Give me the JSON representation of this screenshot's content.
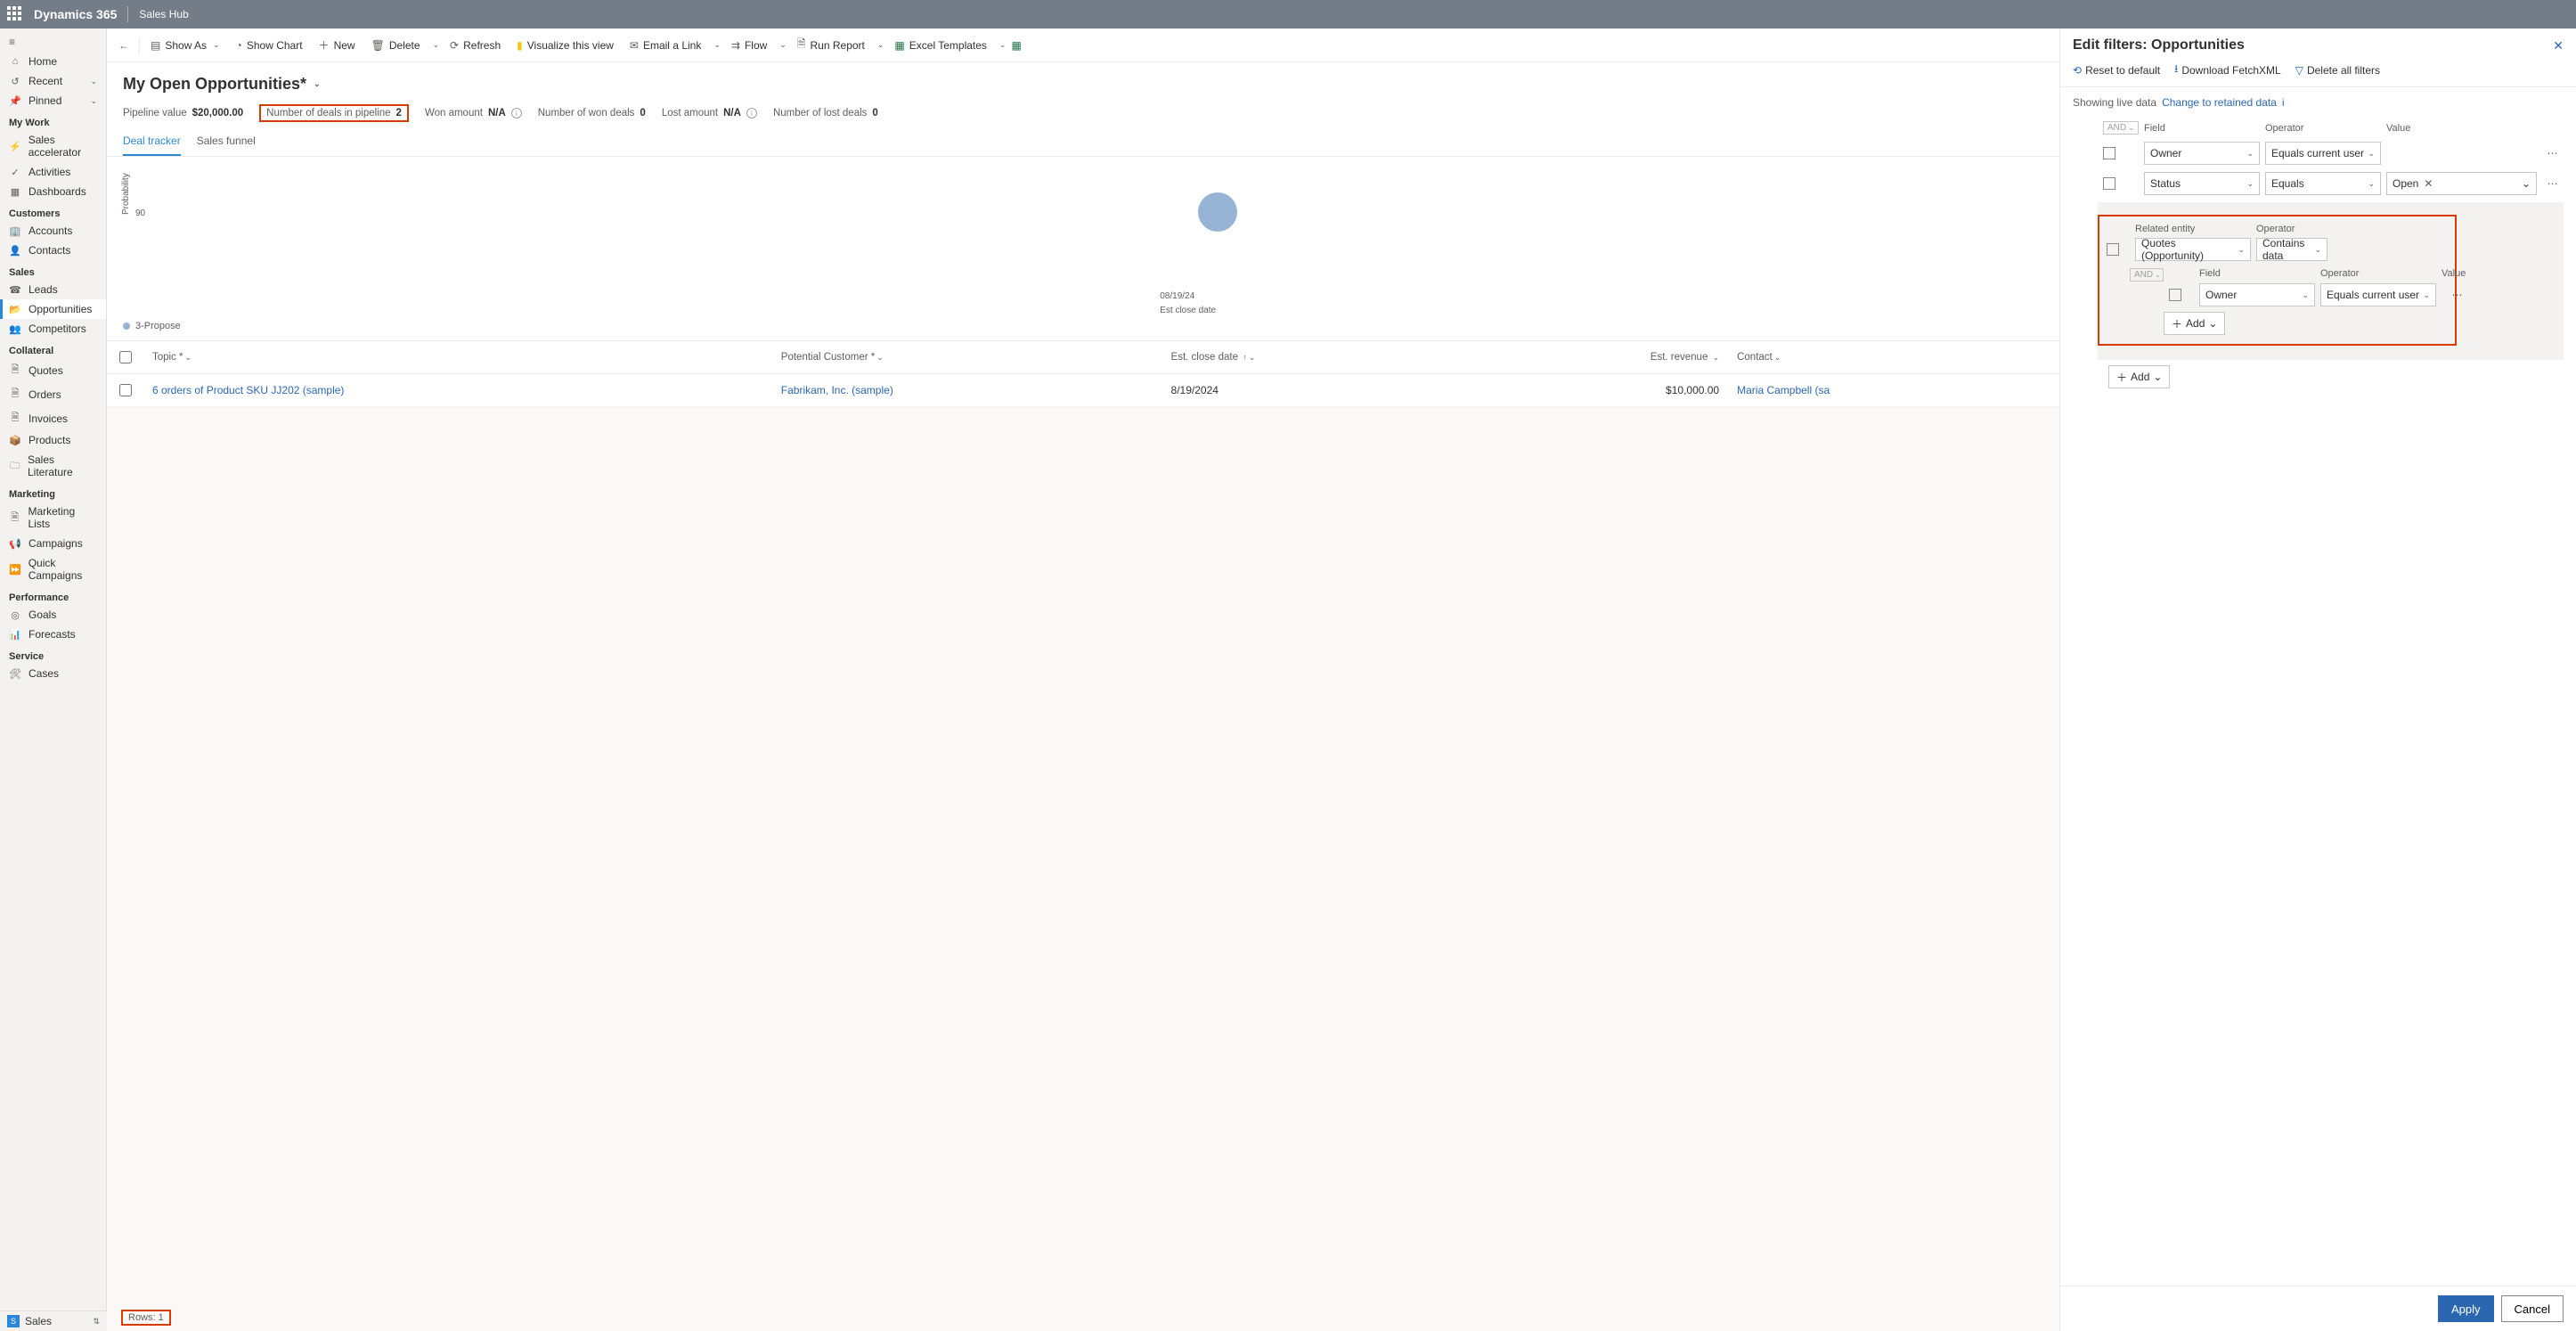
{
  "topbar": {
    "brand": "Dynamics 365",
    "app": "Sales Hub"
  },
  "nav": {
    "top": [
      {
        "icon": "⌂",
        "label": "Home"
      },
      {
        "icon": "↺",
        "label": "Recent",
        "chev": true
      },
      {
        "icon": "📌",
        "label": "Pinned",
        "chev": true
      }
    ],
    "groups": [
      {
        "title": "My Work",
        "items": [
          {
            "icon": "⚡",
            "label": "Sales accelerator"
          },
          {
            "icon": "✓",
            "label": "Activities"
          },
          {
            "icon": "▦",
            "label": "Dashboards"
          }
        ]
      },
      {
        "title": "Customers",
        "items": [
          {
            "icon": "🏢",
            "label": "Accounts"
          },
          {
            "icon": "👤",
            "label": "Contacts"
          }
        ]
      },
      {
        "title": "Sales",
        "items": [
          {
            "icon": "☎",
            "label": "Leads"
          },
          {
            "icon": "📂",
            "label": "Opportunities",
            "selected": true
          },
          {
            "icon": "👥",
            "label": "Competitors"
          }
        ]
      },
      {
        "title": "Collateral",
        "items": [
          {
            "icon": "🗎",
            "label": "Quotes"
          },
          {
            "icon": "🗎",
            "label": "Orders"
          },
          {
            "icon": "🗎",
            "label": "Invoices"
          },
          {
            "icon": "📦",
            "label": "Products"
          },
          {
            "icon": "🗀",
            "label": "Sales Literature"
          }
        ]
      },
      {
        "title": "Marketing",
        "items": [
          {
            "icon": "🗎",
            "label": "Marketing Lists"
          },
          {
            "icon": "📢",
            "label": "Campaigns"
          },
          {
            "icon": "⏩",
            "label": "Quick Campaigns"
          }
        ]
      },
      {
        "title": "Performance",
        "items": [
          {
            "icon": "◎",
            "label": "Goals"
          },
          {
            "icon": "📊",
            "label": "Forecasts"
          }
        ]
      },
      {
        "title": "Service",
        "items": [
          {
            "icon": "🛠",
            "label": "Cases"
          }
        ]
      }
    ],
    "area": "Sales"
  },
  "commands": {
    "showAs": "Show As",
    "showChart": "Show Chart",
    "new": "New",
    "delete": "Delete",
    "refresh": "Refresh",
    "visualize": "Visualize this view",
    "emailLink": "Email a Link",
    "flow": "Flow",
    "runReport": "Run Report",
    "excelTemplates": "Excel Templates"
  },
  "view": {
    "title": "My Open Opportunities*"
  },
  "metrics": {
    "pipelineValueLabel": "Pipeline value",
    "pipelineValue": "$20,000.00",
    "dealsLabel": "Number of deals in pipeline",
    "dealsVal": "2",
    "wonAmtLabel": "Won amount",
    "wonAmtVal": "N/A",
    "wonDealsLabel": "Number of won deals",
    "wonDealsVal": "0",
    "lostAmtLabel": "Lost amount",
    "lostAmtVal": "N/A",
    "lostDealsLabel": "Number of lost deals",
    "lostDealsVal": "0"
  },
  "tabs": {
    "dealTracker": "Deal tracker",
    "salesFunnel": "Sales funnel"
  },
  "chart_data": {
    "type": "scatter",
    "xlabel": "Est close date",
    "ylabel": "Probability",
    "yticks": [
      90
    ],
    "xticks": [
      "08/19/24"
    ],
    "series": [
      {
        "name": "3-Propose",
        "color": "#97b3d6",
        "points": [
          {
            "x": "08/19/24",
            "y": 90
          }
        ]
      }
    ]
  },
  "legend": "3-Propose",
  "grid": {
    "cols": {
      "topic": "Topic *",
      "customer": "Potential Customer *",
      "close": "Est. close date",
      "revenue": "Est. revenue",
      "contact": "Contact"
    },
    "rows": [
      {
        "topic": "6 orders of Product SKU JJ202 (sample)",
        "customer": "Fabrikam, Inc. (sample)",
        "close": "8/19/2024",
        "revenue": "$10,000.00",
        "contact": "Maria Campbell (sa"
      }
    ],
    "footer": "Rows: 1"
  },
  "panel": {
    "title": "Edit filters: Opportunities",
    "reset": "Reset to default",
    "download": "Download FetchXML",
    "deleteAll": "Delete all filters",
    "showing": "Showing live data",
    "changeLink": "Change to retained data",
    "headers": {
      "field": "Field",
      "operator": "Operator",
      "value": "Value",
      "relatedEntity": "Related entity"
    },
    "and": "AND",
    "rows": [
      {
        "field": "Owner",
        "operator": "Equals current user",
        "value": ""
      },
      {
        "field": "Status",
        "operator": "Equals",
        "valueTag": "Open"
      }
    ],
    "nested": {
      "entity": "Quotes (Opportunity)",
      "entityOp": "Contains data",
      "row": {
        "field": "Owner",
        "operator": "Equals current user"
      }
    },
    "add": "Add",
    "apply": "Apply",
    "cancel": "Cancel"
  }
}
